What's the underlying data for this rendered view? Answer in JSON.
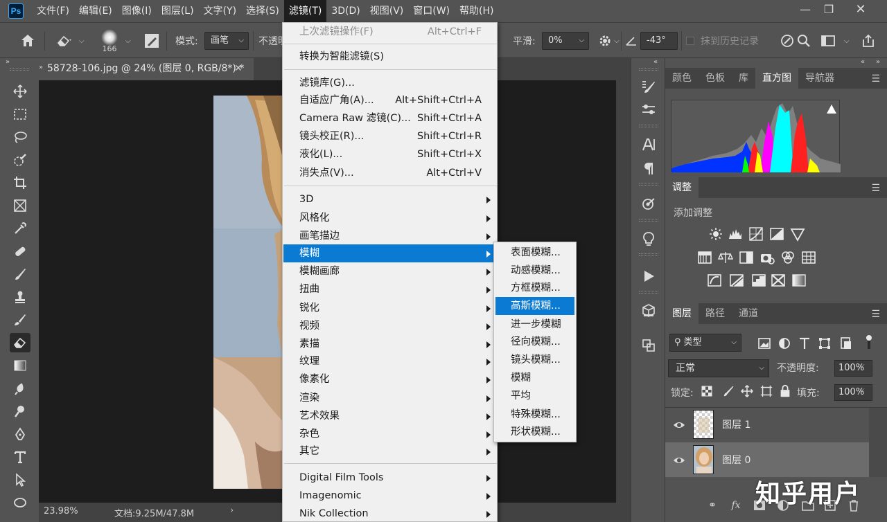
{
  "menubar": {
    "logo": "Ps",
    "items": [
      "文件(F)",
      "编辑(E)",
      "图像(I)",
      "图层(L)",
      "文字(Y)",
      "选择(S)",
      "滤镜(T)",
      "3D(D)",
      "视图(V)",
      "窗口(W)",
      "帮助(H)"
    ],
    "active_index": 6
  },
  "options": {
    "brush_size": "166",
    "mode_label": "模式:",
    "mode_value": "画笔",
    "opacity_label": "不透明",
    "smooth_label": "平滑:",
    "smooth_value": "0%",
    "angle_value": "-43°",
    "history_label": "抹到历史记录"
  },
  "document": {
    "tab_title": "58728-106.jpg @ 24% (图层 0, RGB/8*) *",
    "zoom": "23.98%",
    "doc_info": "文档:9.25M/47.8M"
  },
  "filter_menu": {
    "items": [
      {
        "label": "上次滤镜操作(F)",
        "shortcut": "Alt+Ctrl+F",
        "disabled": true
      },
      {
        "label": "转换为智能滤镜(S)"
      },
      {
        "label": "滤镜库(G)..."
      },
      {
        "label": "自适应广角(A)...",
        "shortcut": "Alt+Shift+Ctrl+A"
      },
      {
        "label": "Camera Raw 滤镜(C)...",
        "shortcut": "Shift+Ctrl+A"
      },
      {
        "label": "镜头校正(R)...",
        "shortcut": "Shift+Ctrl+R"
      },
      {
        "label": "液化(L)...",
        "shortcut": "Shift+Ctrl+X"
      },
      {
        "label": "消失点(V)...",
        "shortcut": "Alt+Ctrl+V"
      },
      {
        "label": "3D",
        "submenu": true
      },
      {
        "label": "风格化",
        "submenu": true
      },
      {
        "label": "画笔描边",
        "submenu": true
      },
      {
        "label": "模糊",
        "submenu": true,
        "highlighted": true
      },
      {
        "label": "模糊画廊",
        "submenu": true
      },
      {
        "label": "扭曲",
        "submenu": true
      },
      {
        "label": "锐化",
        "submenu": true
      },
      {
        "label": "视频",
        "submenu": true
      },
      {
        "label": "素描",
        "submenu": true
      },
      {
        "label": "纹理",
        "submenu": true
      },
      {
        "label": "像素化",
        "submenu": true
      },
      {
        "label": "渲染",
        "submenu": true
      },
      {
        "label": "艺术效果",
        "submenu": true
      },
      {
        "label": "杂色",
        "submenu": true
      },
      {
        "label": "其它",
        "submenu": true
      },
      {
        "label": "Digital Film Tools",
        "submenu": true
      },
      {
        "label": "Imagenomic",
        "submenu": true
      },
      {
        "label": "Nik Collection",
        "submenu": true
      }
    ]
  },
  "blur_submenu": {
    "items": [
      "表面模糊...",
      "动感模糊...",
      "方框模糊...",
      "高斯模糊...",
      "进一步模糊",
      "径向模糊...",
      "镜头模糊...",
      "模糊",
      "平均",
      "特殊模糊...",
      "形状模糊..."
    ],
    "highlighted_index": 3
  },
  "panels": {
    "top_tabs": [
      "颜色",
      "色板",
      "库",
      "直方图",
      "导航器"
    ],
    "top_active": 3,
    "adjust_tab": "调整",
    "adjust_add": "添加调整",
    "layer_tabs": [
      "图层",
      "路径",
      "通道"
    ],
    "layer_filter": "类型",
    "blend_mode": "正常",
    "opacity_label": "不透明度:",
    "opacity_value": "100%",
    "lock_label": "锁定:",
    "fill_label": "填充:",
    "fill_value": "100%",
    "layers": [
      "图层 1",
      "图层 0"
    ]
  },
  "watermark": "知乎用户",
  "colors": {
    "menu_highlight": "#0b7ad2",
    "ui_panel": "#535353",
    "ui_dark": "#424242"
  }
}
